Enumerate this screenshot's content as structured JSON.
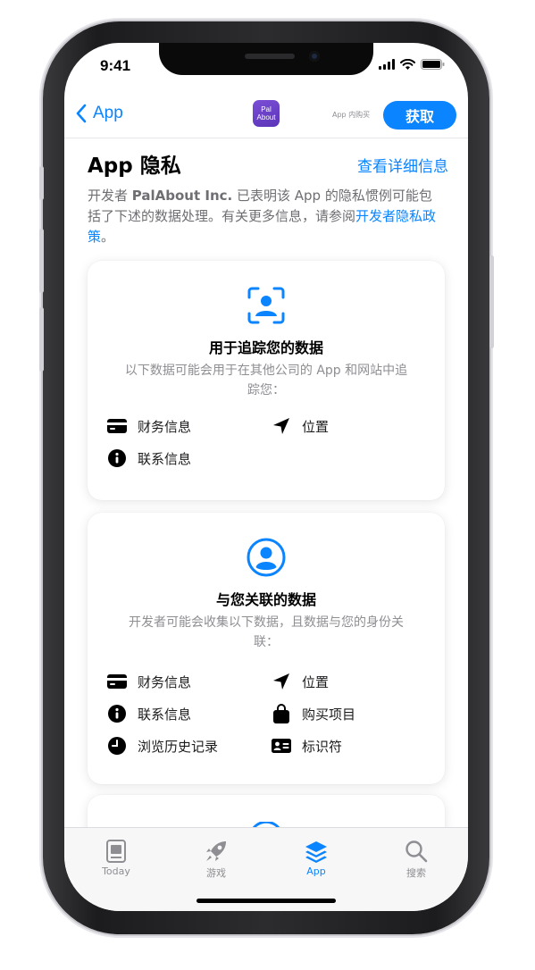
{
  "status_bar": {
    "time": "9:41"
  },
  "nav": {
    "back_label": "App",
    "app_icon_text": "Pal\nAbout",
    "in_app_purchase": "App 内购买",
    "get_button": "获取"
  },
  "header": {
    "title": "App 隐私",
    "see_details": "查看详细信息",
    "description_prefix": "开发者 ",
    "developer": "PalAbout Inc.",
    "description_suffix": " 已表明该 App 的隐私惯例可能包括了下述的数据处理。有关更多信息，请参阅",
    "policy_link": "开发者隐私政策",
    "period": "。"
  },
  "cards": {
    "tracking": {
      "title": "用于追踪您的数据",
      "subtitle": "以下数据可能会用于在其他公司的 App 和网站中追踪您：",
      "items": [
        {
          "label": "财务信息",
          "icon": "credit-card-icon"
        },
        {
          "label": "位置",
          "icon": "location-arrow-icon"
        },
        {
          "label": "联系信息",
          "icon": "info-circle-icon"
        }
      ]
    },
    "linked": {
      "title": "与您关联的数据",
      "subtitle": "开发者可能会收集以下数据，且数据与您的身份关联：",
      "items": [
        {
          "label": "财务信息",
          "icon": "credit-card-icon"
        },
        {
          "label": "位置",
          "icon": "location-arrow-icon"
        },
        {
          "label": "联系信息",
          "icon": "info-circle-icon"
        },
        {
          "label": "购买项目",
          "icon": "shopping-bag-icon"
        },
        {
          "label": "浏览历史记录",
          "icon": "clock-icon"
        },
        {
          "label": "标识符",
          "icon": "id-card-icon"
        }
      ]
    }
  },
  "tabbar": {
    "tabs": [
      {
        "label": "Today",
        "icon": "today-icon"
      },
      {
        "label": "游戏",
        "icon": "rocket-icon"
      },
      {
        "label": "App",
        "icon": "app-stack-icon"
      },
      {
        "label": "搜索",
        "icon": "search-icon"
      }
    ]
  },
  "colors": {
    "accent": "#0a84ff",
    "secondary_text": "#8e8e93"
  }
}
